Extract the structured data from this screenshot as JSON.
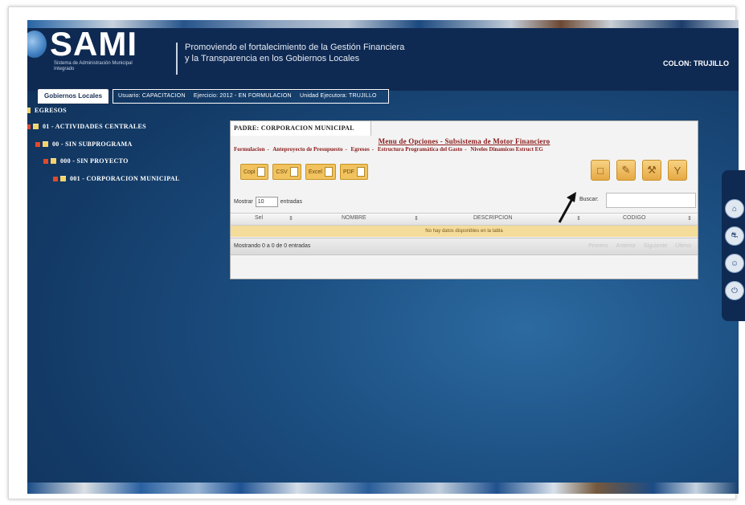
{
  "header": {
    "logo": "SAMI",
    "logo_subtitle": "Sistema de Administración Municipal Integrado",
    "slogan_line1": "Promoviendo el fortalecimiento de la Gestión Financiera",
    "slogan_line2": "y la Transparencia en los Gobiernos Locales",
    "user": "COLON: TRUJILLO"
  },
  "tabs": {
    "active_tab": "Gobiernos Locales",
    "info": {
      "usuario": "Usuario: CAPACITACION",
      "ejercicio": "Ejercicio: 2012 - EN FORMULACION",
      "unidad": "Unidad Ejecutora: TRUJILLO"
    }
  },
  "tree": {
    "items": [
      {
        "label": "EGRESOS"
      },
      {
        "label": "01 - ACTIVIDADES CENTRALES"
      },
      {
        "label": "00 - SIN SUBPROGRAMA"
      },
      {
        "label": "000 - SIN PROYECTO"
      },
      {
        "label": "001 - CORPORACION MUNICIPAL"
      }
    ]
  },
  "panel": {
    "tab_title": "PADRE: CORPORACION MUNICIPAL",
    "menu_title": "Menu de Opciones - Subsistema de Motor Financiero",
    "menu_items": [
      "Formulacion",
      "Anteproyecto de Presupuesto",
      "Egresos",
      "Estructura Programática del Gasto",
      "Niveles Dinamicos Estruct EG"
    ],
    "export_buttons": [
      "Copi",
      "CSV",
      "Excel",
      "PDF"
    ],
    "tool_icons": [
      "new-document-icon",
      "edit-pencil-icon",
      "wrench-icon",
      "filter-icon"
    ],
    "show_label": "Mostrar",
    "show_value": "10",
    "entries_label": "entradas",
    "search_label": "Buscar:",
    "search_value": "",
    "columns": [
      "Sel",
      "NOMBRE",
      "DESCRIPCION",
      "CODIGO"
    ],
    "empty_message": "No hay datos disponibles en la tabla",
    "info_text": "Mostrando 0 a 0 de 0 entradas",
    "pager": [
      "Primero",
      "Anterior",
      "Siguiente",
      "Último"
    ]
  },
  "sidebar_icons": [
    "home-icon",
    "car-icon",
    "user-icon",
    "power-icon"
  ],
  "colors": {
    "header_bg": "#0f2a52",
    "menu_red": "#8a1a1a",
    "button_gold": "#f1c25e"
  }
}
